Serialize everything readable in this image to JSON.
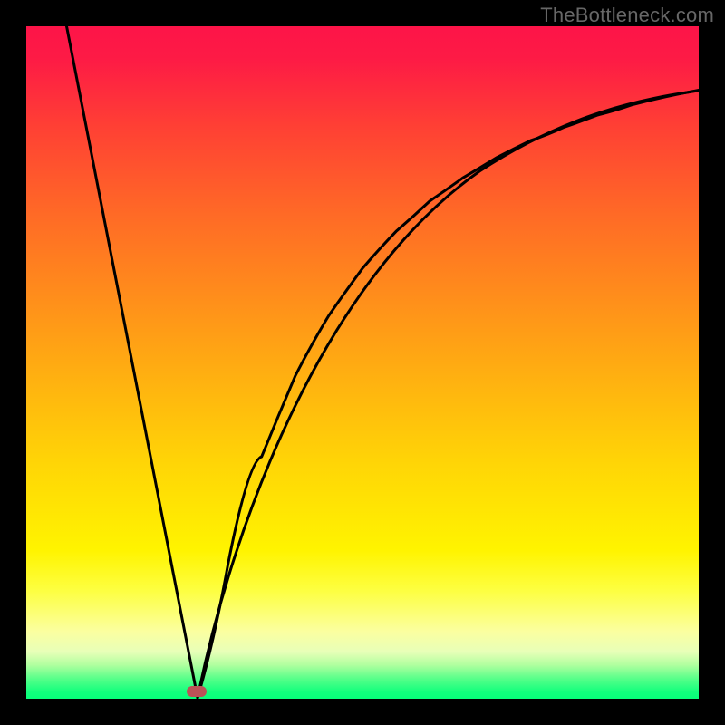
{
  "watermark": "TheBottleneck.com",
  "chart_data": {
    "type": "line",
    "title": "",
    "xlabel": "",
    "ylabel": "",
    "xlim": [
      0,
      100
    ],
    "ylim": [
      0,
      100
    ],
    "grid": false,
    "legend": false,
    "annotations": [],
    "background_gradient": {
      "orientation": "vertical",
      "stops": [
        {
          "pos": 0,
          "color": "#fd1448"
        },
        {
          "pos": 50,
          "color": "#ffa414"
        },
        {
          "pos": 80,
          "color": "#fff400"
        },
        {
          "pos": 97,
          "color": "#58ff8a"
        },
        {
          "pos": 100,
          "color": "#07ff7a"
        }
      ]
    },
    "series": [
      {
        "name": "left-branch",
        "type": "line",
        "x": [
          6,
          25.5
        ],
        "y": [
          100,
          0
        ],
        "note": "straight descending segment"
      },
      {
        "name": "right-branch",
        "type": "line",
        "x": [
          25.5,
          30,
          35,
          40,
          45,
          50,
          55,
          60,
          65,
          70,
          75,
          80,
          85,
          90,
          95,
          100
        ],
        "y": [
          0,
          20,
          36,
          48,
          57,
          64,
          69.5,
          74,
          77.5,
          80.5,
          83,
          85,
          86.8,
          88.3,
          89.5,
          90.5
        ],
        "note": "rising saturating curve"
      }
    ],
    "marker": {
      "x": 25.5,
      "y": 0,
      "color": "#bb5257",
      "shape": "pill"
    }
  }
}
